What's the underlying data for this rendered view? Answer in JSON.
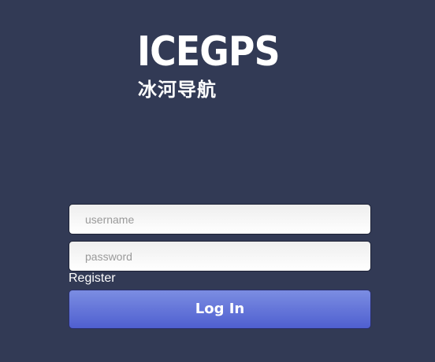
{
  "logo": {
    "wordmark": "ICEGPS",
    "subtitle": "冰河导航"
  },
  "form": {
    "username_placeholder": "username",
    "username_value": "",
    "password_placeholder": "password",
    "password_value": "",
    "register_label": "Register",
    "login_label": "Log In"
  },
  "colors": {
    "background": "#323a55",
    "button_top": "#7b8de2",
    "button_bottom": "#4f5fd0"
  }
}
